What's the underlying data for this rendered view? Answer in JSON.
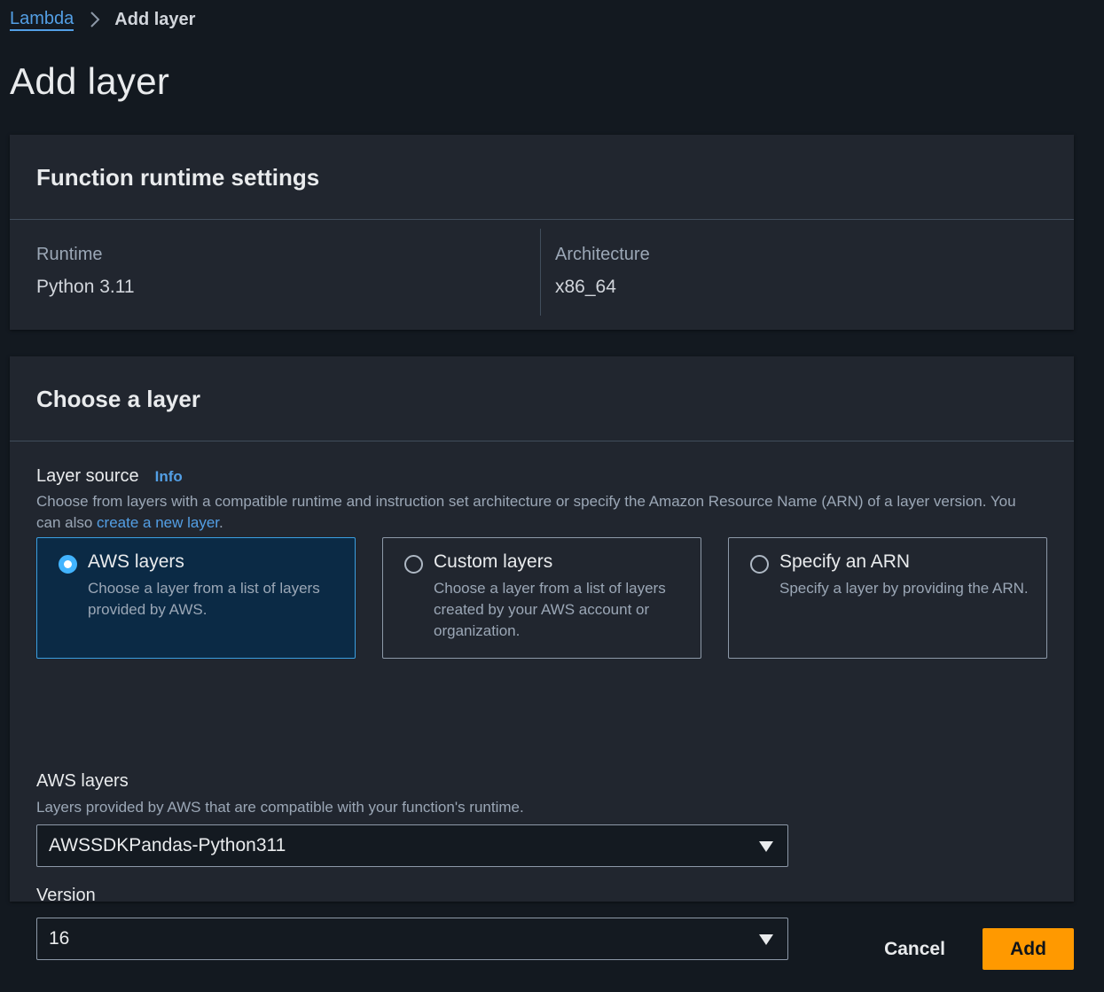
{
  "breadcrumb": {
    "parent_label": "Lambda",
    "current_label": "Add layer"
  },
  "page_title": "Add layer",
  "runtime_settings": {
    "heading": "Function runtime settings",
    "runtime_label": "Runtime",
    "runtime_value": "Python 3.11",
    "architecture_label": "Architecture",
    "architecture_value": "x86_64"
  },
  "choose_layer": {
    "heading": "Choose a layer",
    "layer_source_label": "Layer source",
    "info_link": "Info",
    "description_prefix": "Choose from layers with a compatible runtime and instruction set architecture or specify the Amazon Resource Name (ARN) of a layer version. You can also ",
    "description_link": "create a new layer",
    "description_suffix": ".",
    "options": [
      {
        "title": "AWS layers",
        "description": "Choose a layer from a list of layers provided by AWS.",
        "selected": true
      },
      {
        "title": "Custom layers",
        "description": "Choose a layer from a list of layers created by your AWS account or organization.",
        "selected": false
      },
      {
        "title": "Specify an ARN",
        "description": "Specify a layer by providing the ARN.",
        "selected": false
      }
    ],
    "aws_layers_label": "AWS layers",
    "aws_layers_description": "Layers provided by AWS that are compatible with your function's runtime.",
    "aws_layers_value": "AWSSDKPandas-Python311",
    "version_label": "Version",
    "version_value": "16"
  },
  "footer": {
    "cancel_label": "Cancel",
    "add_label": "Add"
  },
  "colors": {
    "background": "#131920",
    "container": "#21262f",
    "link": "#539fe5",
    "primary_button": "#ff9900",
    "selected_radio": "#42b4ff"
  }
}
